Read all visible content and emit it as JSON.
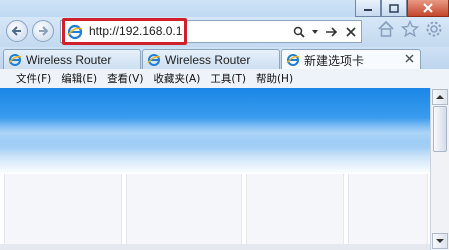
{
  "address_bar": {
    "url": "http://192.168.0.1"
  },
  "tabs": [
    {
      "label": "Wireless Router",
      "active": false
    },
    {
      "label": "Wireless Router",
      "active": false
    },
    {
      "label": "新建选项卡",
      "active": true
    }
  ],
  "menu": {
    "items": [
      "文件(F)",
      "编辑(E)",
      "查看(V)",
      "收藏夹(A)",
      "工具(T)",
      "帮助(H)"
    ]
  },
  "icons": {
    "back": "back-arrow-icon",
    "forward": "forward-arrow-icon",
    "ie_logo": "ie-logo-icon",
    "search": "search-icon",
    "dropdown": "chevron-down-icon",
    "go": "go-arrow-icon",
    "stop": "stop-x-icon",
    "home": "home-icon",
    "favorites": "star-icon",
    "tools": "gear-icon",
    "minimize": "minimize-icon",
    "maximize": "maximize-icon",
    "close": "close-icon"
  },
  "colors": {
    "highlight_border": "#d0202a",
    "banner_blue": "#1a86e6"
  }
}
